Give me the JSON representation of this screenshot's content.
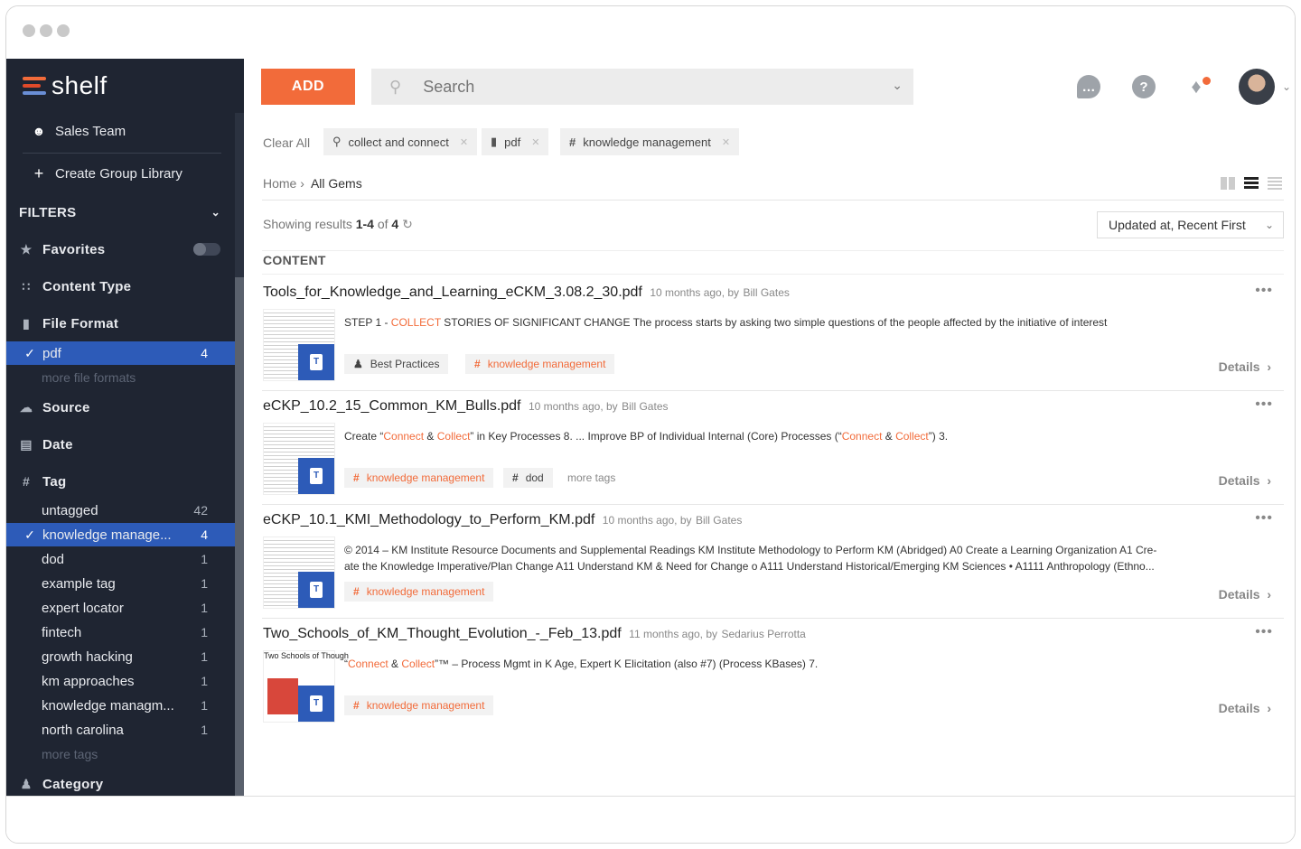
{
  "brand": {
    "name": "shelf",
    "accent": "#f26b3a",
    "selected": "#2d5bb8",
    "sidebar_bg": "#1f2532"
  },
  "sidebar": {
    "team": "Sales Team",
    "create_group": "Create Group Library",
    "filters_label": "FILTERS",
    "favorites": "Favorites",
    "content_type": "Content Type",
    "file_format": "File Format",
    "file_formats": [
      {
        "label": "pdf",
        "count": "4"
      }
    ],
    "more_file_formats": "more file formats",
    "source": "Source",
    "date": "Date",
    "tag": "Tag",
    "tags": [
      {
        "label": "untagged",
        "count": "42"
      },
      {
        "label": "knowledge manage...",
        "count": "4"
      },
      {
        "label": "dod",
        "count": "1"
      },
      {
        "label": "example tag",
        "count": "1"
      },
      {
        "label": "expert locator",
        "count": "1"
      },
      {
        "label": "fintech",
        "count": "1"
      },
      {
        "label": "growth hacking",
        "count": "1"
      },
      {
        "label": "km approaches",
        "count": "1"
      },
      {
        "label": "knowledge managm...",
        "count": "1"
      },
      {
        "label": "north carolina",
        "count": "1"
      }
    ],
    "more_tags": "more tags",
    "category": "Category"
  },
  "toolbar": {
    "add_label": "ADD",
    "search_placeholder": "Search"
  },
  "active_filters": {
    "clear_all": "Clear All",
    "chips": [
      "collect and connect",
      "pdf",
      "knowledge management"
    ]
  },
  "breadcrumb": {
    "home": "Home",
    "sep": "›",
    "current": "All Gems"
  },
  "results": {
    "prefix": "Showing results",
    "range": "1-4",
    "of": "of",
    "total": "4",
    "sort": "Updated at, Recent First",
    "section": "CONTENT"
  },
  "items": [
    {
      "title": "Tools_for_Knowledge_and_Learning_eCKM_3.08.2_30.pdf",
      "meta": "10 months ago, by",
      "author": "Bill Gates",
      "snippet_a": "STEP 1 - ",
      "snippet_hl1": "COLLECT",
      "snippet_b": " STORIES OF SIGNIFICANT CHANGE The process starts by asking two simple questions of the people affected by the initiative of interest",
      "tag1": "Best Practices",
      "tag2": "knowledge management",
      "details": "Details"
    },
    {
      "title": "eCKP_10.2_15_Common_KM_Bulls.pdf",
      "meta": "10 months ago, by",
      "author": "Bill Gates",
      "snippet_a": "Create “",
      "snippet_hl1": "Connect",
      "snippet_amp": " & ",
      "snippet_hl2": "Collect",
      "snippet_b": "” in Key Processes 8. ... Improve BP of Individual Internal (Core) Processes (“",
      "snippet_hl3": "Connect",
      "snippet_amp2": " & ",
      "snippet_hl4": "Collect",
      "snippet_c": "”) 3.",
      "tag1": "knowledge management",
      "tag2": "dod",
      "more_tags": "more tags",
      "details": "Details"
    },
    {
      "title": "eCKP_10.1_KMI_Methodology_to_Perform_KM.pdf",
      "meta": "10 months ago, by",
      "author": "Bill Gates",
      "snippet": "© 2014 – KM Institute Resource Documents and Supplemental Readings KM Institute Methodology to Perform KM (Abridged) A0 Create a Learning Organization A1 Cre-ate the Knowledge Imperative/Plan Change A11 Understand KM & Need for Change o A111 Understand Historical/Emerging KM Sciences • A1111 Anthropology (Ethno...",
      "tag1": "knowledge management",
      "details": "Details"
    },
    {
      "title": "Two_Schools_of_KM_Thought_Evolution_-_Feb_13.pdf",
      "meta": "11 months ago, by",
      "author": "Sedarius Perrotta",
      "snippet_a": "“",
      "snippet_hl1": "Connect",
      "snippet_amp": " & ",
      "snippet_hl2": "Collect",
      "snippet_b": "”™ – Process Mgmt in K Age, Expert K Elicitation (also #7) (Process KBases) 7.",
      "thumb_title": "Two Schools of Though",
      "tag1": "knowledge management",
      "details": "Details"
    }
  ],
  "icons": {
    "chat": "chat-icon",
    "help": "help-icon",
    "bell": "bell-icon",
    "search": "search-icon"
  }
}
